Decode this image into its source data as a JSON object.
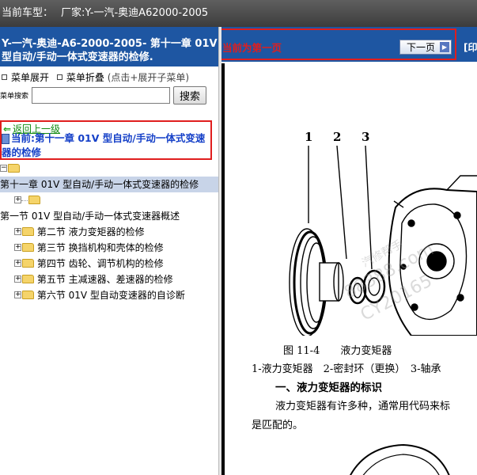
{
  "topbar": {
    "label": "当前车型：",
    "model": "厂家:Y-一汽-奥迪A62000-2005"
  },
  "left": {
    "header_line1": "Y-一汽-奥迪-A6-2000-2005- 第十一章 01V",
    "header_line2": "型自动/手动一体式变速器的检修.",
    "menu": {
      "expand_label": "菜单展开",
      "collapse_label": "菜单折叠",
      "hint": "(点击+展开子菜单)"
    },
    "search": {
      "label": "菜单搜索",
      "value": "",
      "placeholder": "",
      "button_label": "搜索"
    },
    "back_link": "返回上一级",
    "current_label": "当前:第十一章 01V 型自动/手动一体式变速器的检修",
    "tree": {
      "root_label": "第十一章 01V 型自动/手动一体式变速器的检修",
      "overview": "第一节 01V 型自动/手动一体式变速器概述",
      "items": [
        {
          "label": "第二节 液力变矩器的检修"
        },
        {
          "label": "第三节 换挡机构和壳体的检修"
        },
        {
          "label": "第四节 齿轮、调节机构的检修"
        },
        {
          "label": "第五节 主减速器、差速器的检修"
        },
        {
          "label": "第六节 01V 型自动变速器的自诊断"
        }
      ]
    }
  },
  "right": {
    "page_status": "当前为第一页",
    "next_button": "下一页",
    "print_link": "[印",
    "figure_labels": [
      "1",
      "2",
      "3"
    ],
    "caption": "图 11-4　　液力变矩器",
    "legend": "1-液力变矩器　2-密封环（更换）　3-轴承",
    "section_title": "一、液力变矩器的标识",
    "body_line1": "液力变矩器有许多种，通常用代码来标",
    "body_line2": "是匹配的。",
    "watermark1": "汽修帮手",
    "watermark2": "88388.com",
    "watermark3": "CY20165"
  }
}
